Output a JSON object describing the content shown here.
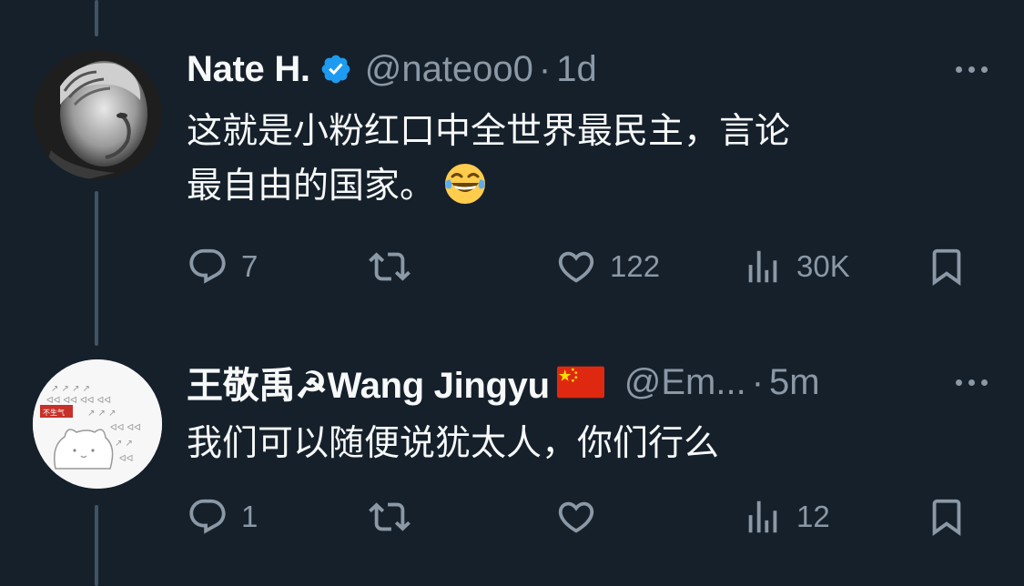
{
  "tweets": [
    {
      "name": "Nate H.",
      "verified": true,
      "handle": "@nateoo0",
      "separator": "·",
      "time": "1d",
      "text_line1": "这就是小粉红口中全世界最民主，言论",
      "text_line2": "最自由的国家。",
      "emoji": "face-with-tears-of-joy",
      "replies": "7",
      "reposts": "",
      "likes": "122",
      "views": "30K"
    },
    {
      "name": "王敬禹☭Wang Jingyu",
      "flag": "china-flag",
      "handle": "@Em...",
      "separator": "·",
      "time": "5m",
      "text_line1": "我们可以随便说犹太人，你们行么",
      "replies": "1",
      "reposts": "",
      "likes": "",
      "views": "12"
    }
  ],
  "colors": {
    "background": "#15202b",
    "primary_text": "#f7f9f9",
    "secondary_text": "#8b98a5",
    "verified_blue": "#1d9bf0",
    "thread_line": "#425364"
  }
}
